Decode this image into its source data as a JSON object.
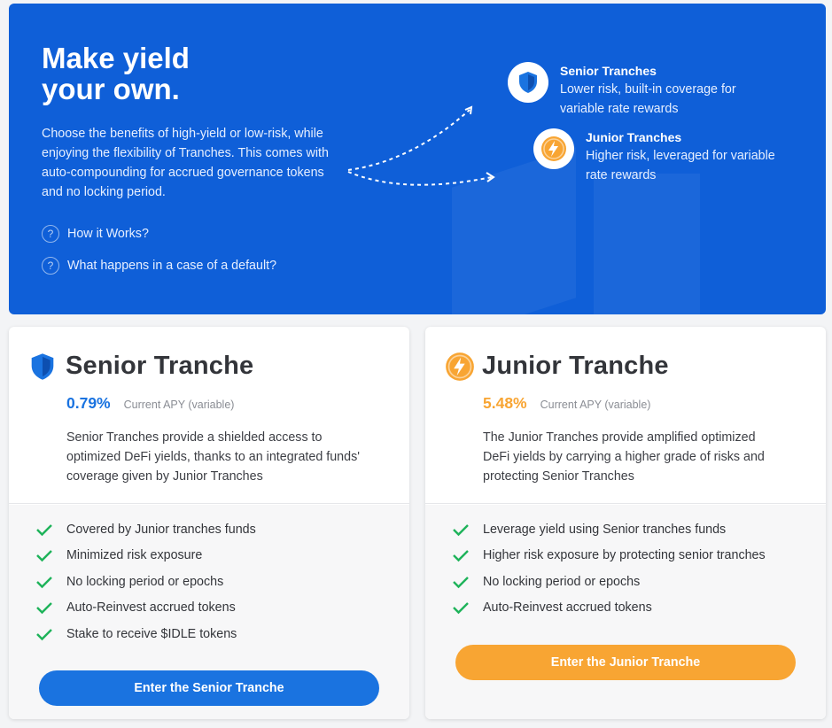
{
  "hero": {
    "title_line1": "Make yield",
    "title_line2": "your own.",
    "description": "Choose the benefits of high-yield or low-risk, while enjoying the flexibility of Tranches. This comes with auto-compounding for accrued governance tokens and no locking period.",
    "faq": [
      {
        "label": "How it Works?",
        "icon": "question-icon"
      },
      {
        "label": "What happens in a case of a default?",
        "icon": "question-icon"
      }
    ],
    "tranches": [
      {
        "title": "Senior Tranches",
        "line1": "Lower risk, built-in coverage for",
        "line2": "variable rate rewards",
        "icon": "shield-icon"
      },
      {
        "title": "Junior Tranches",
        "line1": "Higher risk, leveraged for variable",
        "line2": "rate rewards",
        "icon": "lightning-icon"
      }
    ]
  },
  "senior": {
    "title": "Senior Tranche",
    "apy": "0.79%",
    "apy_label": "Current APY (variable)",
    "description": "Senior Tranches provide a shielded access to optimized DeFi yields, thanks to an integrated funds' coverage given by Junior Tranches",
    "features": [
      "Covered by Junior tranches funds",
      "Minimized risk exposure",
      "No locking period or epochs",
      "Auto-Reinvest accrued tokens",
      "Stake to receive $IDLE tokens"
    ],
    "button": "Enter the Senior Tranche",
    "color": "#1a73e0"
  },
  "junior": {
    "title": "Junior Tranche",
    "apy": "5.48%",
    "apy_label": "Current APY (variable)",
    "description": "The Junior Tranches provide amplified optimized DeFi yields by carrying a higher grade of risks and protecting Senior Tranches",
    "features": [
      "Leverage yield using Senior tranches funds",
      "Higher risk exposure by protecting senior tranches",
      "No locking period or epochs",
      "Auto-Reinvest accrued tokens"
    ],
    "button": "Enter the Junior Tranche",
    "color": "#f8a533"
  },
  "colors": {
    "hero_bg": "#0f5fd8",
    "check": "#1eb35a"
  }
}
